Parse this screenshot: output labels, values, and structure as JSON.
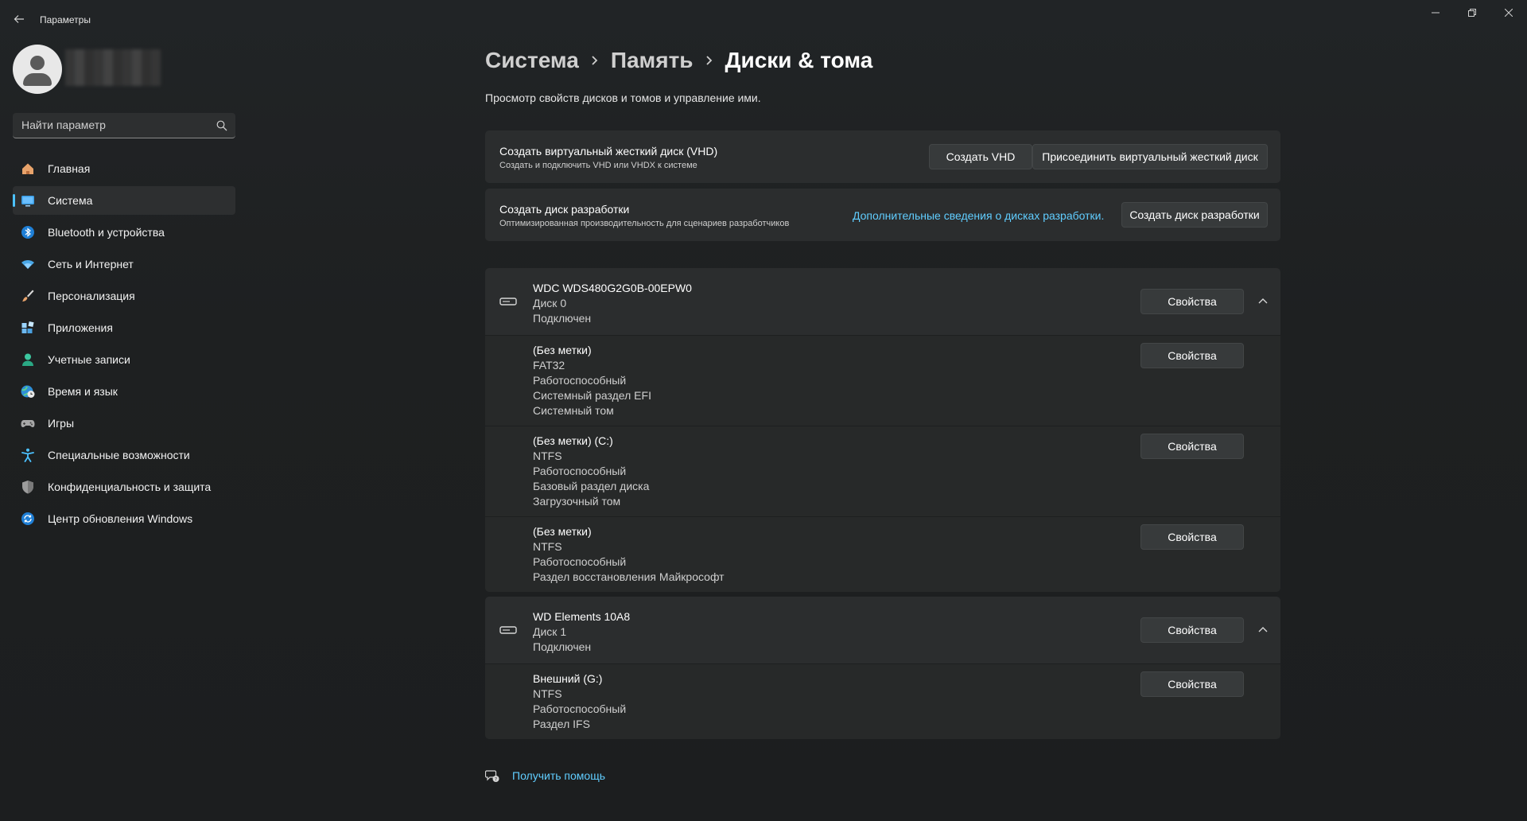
{
  "window": {
    "title": "Параметры",
    "back_icon": "arrow-left-icon",
    "controls": [
      "minimize-icon",
      "maximize-icon",
      "close-icon"
    ]
  },
  "search": {
    "placeholder": "Найти параметр"
  },
  "sidebar": {
    "items": [
      {
        "label": "Главная",
        "icon": "home-icon"
      },
      {
        "label": "Система",
        "icon": "monitor-icon",
        "active": true
      },
      {
        "label": "Bluetooth и устройства",
        "icon": "bluetooth-icon"
      },
      {
        "label": "Сеть и Интернет",
        "icon": "wifi-icon"
      },
      {
        "label": "Персонализация",
        "icon": "brush-icon"
      },
      {
        "label": "Приложения",
        "icon": "apps-icon"
      },
      {
        "label": "Учетные записи",
        "icon": "person-icon"
      },
      {
        "label": "Время и язык",
        "icon": "globe-clock-icon"
      },
      {
        "label": "Игры",
        "icon": "gamepad-icon"
      },
      {
        "label": "Специальные возможности",
        "icon": "accessibility-icon"
      },
      {
        "label": "Конфиденциальность и защита",
        "icon": "shield-icon"
      },
      {
        "label": "Центр обновления Windows",
        "icon": "update-icon"
      }
    ]
  },
  "breadcrumb": [
    "Система",
    "Память",
    "Диски & тома"
  ],
  "page_description": "Просмотр свойств дисков и томов и управление ими.",
  "vhd_card": {
    "title": "Создать виртуальный жесткий диск (VHD)",
    "subtitle": "Создать и подключить VHD или VHDX к системе",
    "create_button": "Создать VHD",
    "attach_button": "Присоединить виртуальный жесткий диск"
  },
  "dev_card": {
    "title": "Создать диск разработки",
    "subtitle": "Оптимизированная производительность для сценариев разработчиков",
    "link": "Дополнительные сведения о дисках разработки.",
    "button": "Создать диск разработки"
  },
  "properties_label": "Свойства",
  "disks": [
    {
      "name": "WDC WDS480G2G0B-00EPW0",
      "number": "Диск 0",
      "status": "Подключен",
      "partitions": [
        {
          "label": "(Без метки)",
          "details": [
            "FAT32",
            "Работоспособный",
            "Системный раздел EFI",
            "Системный том"
          ]
        },
        {
          "label": "(Без метки) (C:)",
          "details": [
            "NTFS",
            "Работоспособный",
            "Базовый раздел диска",
            "Загрузочный том"
          ]
        },
        {
          "label": "(Без метки)",
          "details": [
            "NTFS",
            "Работоспособный",
            "Раздел восстановления Майкрософт"
          ]
        }
      ]
    },
    {
      "name": "WD Elements 10A8",
      "number": "Диск 1",
      "status": "Подключен",
      "partitions": [
        {
          "label": "Внешний (G:)",
          "details": [
            "NTFS",
            "Работоспособный",
            "Раздел IFS"
          ]
        }
      ]
    }
  ],
  "help": {
    "label": "Получить помощь",
    "icon": "help-chat-icon"
  },
  "colors": {
    "accent": "#4cc2ff",
    "link": "#60cdff",
    "card": "#2b2d2e",
    "background": "#202020"
  }
}
